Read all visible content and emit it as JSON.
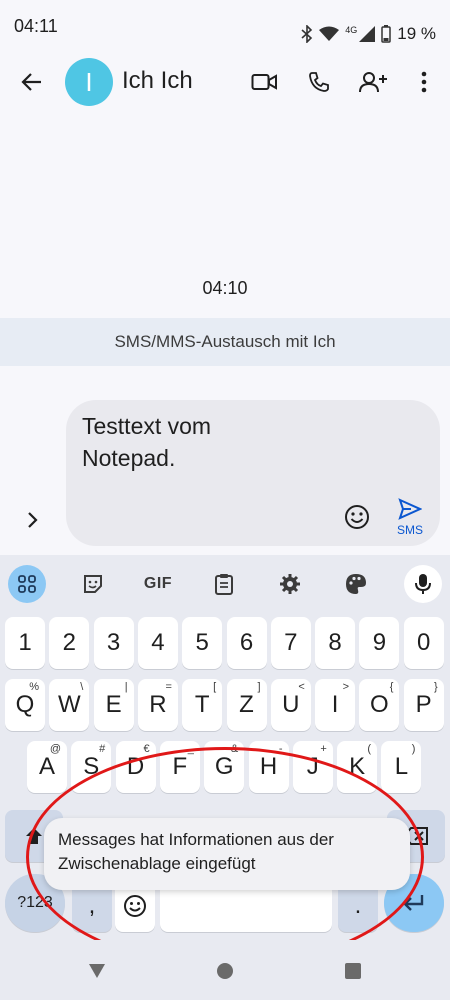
{
  "status_bar": {
    "time": "04:11",
    "network": "4G",
    "battery": "19 %"
  },
  "header": {
    "avatar_letter": "I",
    "contact_name": "Ich Ich",
    "avatar_color": "#4fc6e4"
  },
  "conversation": {
    "timestamp": "04:10",
    "banner": "SMS/MMS-Austausch mit Ich"
  },
  "compose": {
    "text_line1": "Testtext vom",
    "text_line2": "Notepad.",
    "send_label": "SMS"
  },
  "keyboard": {
    "toolbar": {
      "gif_label": "GIF"
    },
    "row_numbers": [
      "1",
      "2",
      "3",
      "4",
      "5",
      "6",
      "7",
      "8",
      "9",
      "0"
    ],
    "row_qwertz": [
      {
        "key": "Q",
        "hint": "%"
      },
      {
        "key": "W",
        "hint": "\\"
      },
      {
        "key": "E",
        "hint": "|"
      },
      {
        "key": "R",
        "hint": "="
      },
      {
        "key": "T",
        "hint": "["
      },
      {
        "key": "Z",
        "hint": "]"
      },
      {
        "key": "U",
        "hint": "<"
      },
      {
        "key": "I",
        "hint": ">"
      },
      {
        "key": "O",
        "hint": "{"
      },
      {
        "key": "P",
        "hint": "}"
      }
    ],
    "row_asdf": [
      {
        "key": "A",
        "hint": "@"
      },
      {
        "key": "S",
        "hint": "#"
      },
      {
        "key": "D",
        "hint": "€"
      },
      {
        "key": "F",
        "hint": "_"
      },
      {
        "key": "G",
        "hint": "&"
      },
      {
        "key": "H",
        "hint": "-"
      },
      {
        "key": "J",
        "hint": "+"
      },
      {
        "key": "K",
        "hint": "("
      },
      {
        "key": "L",
        "hint": ")"
      }
    ],
    "sym_label": "?123",
    "comma_label": ",",
    "period_label": "."
  },
  "toast": {
    "message": "Messages hat Informationen aus der Zwischenablage eingefügt"
  },
  "colors": {
    "accent": "#0b57d0",
    "highlight_ring": "#e01818",
    "keyboard_bg": "#e8eaf1"
  }
}
